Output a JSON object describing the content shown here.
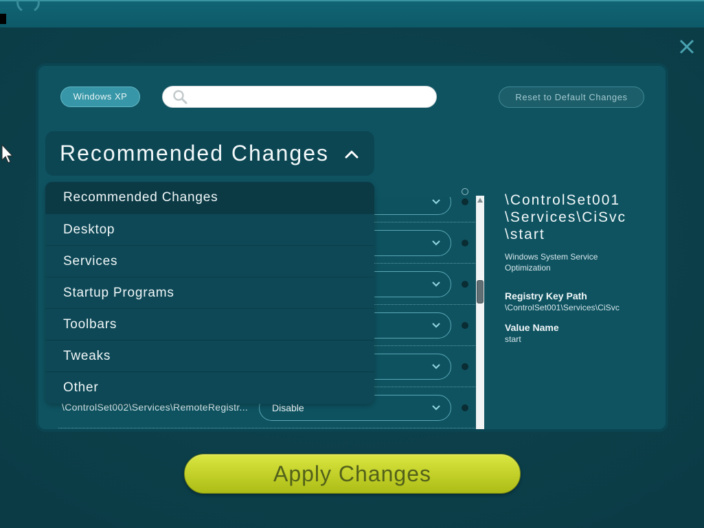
{
  "toolbar": {
    "os_label": "Windows XP",
    "search": {
      "value": "",
      "icon": "search-icon"
    },
    "reset_label": "Reset to Default Changes",
    "close_icon": "close-icon"
  },
  "category_dropdown": {
    "selected": "Recommended Changes",
    "expanded": true,
    "toggle_icon": "chevron-up-icon",
    "options": [
      "Recommended Changes",
      "Desktop",
      "Services",
      "Startup Programs",
      "Toolbars",
      "Tweaks",
      "Other"
    ]
  },
  "changes_list": {
    "rows": [
      {
        "path": "",
        "value": ""
      },
      {
        "path": "",
        "value": ""
      },
      {
        "path": "",
        "value": ""
      },
      {
        "path": "",
        "value": ""
      },
      {
        "path": "",
        "value": ""
      },
      {
        "path": "\\ControlSet002\\Services\\RemoteRegistr...",
        "value": "Disable"
      }
    ]
  },
  "details": {
    "title_lines": [
      "\\ControlSet001",
      "\\Services\\CiSvc",
      "\\start"
    ],
    "description": "Windows System Service Optimization",
    "registry_key_path_label": "Registry Key Path",
    "registry_key_path": "\\ControlSet001\\Services\\CiSvc",
    "value_name_label": "Value Name",
    "value_name": "start"
  },
  "apply_label": "Apply Changes",
  "colors": {
    "background": "#0b3c46",
    "panel": "#0f5361",
    "accent": "#3796a7",
    "apply_button": "#c5d32c",
    "apply_text": "#52611a"
  }
}
